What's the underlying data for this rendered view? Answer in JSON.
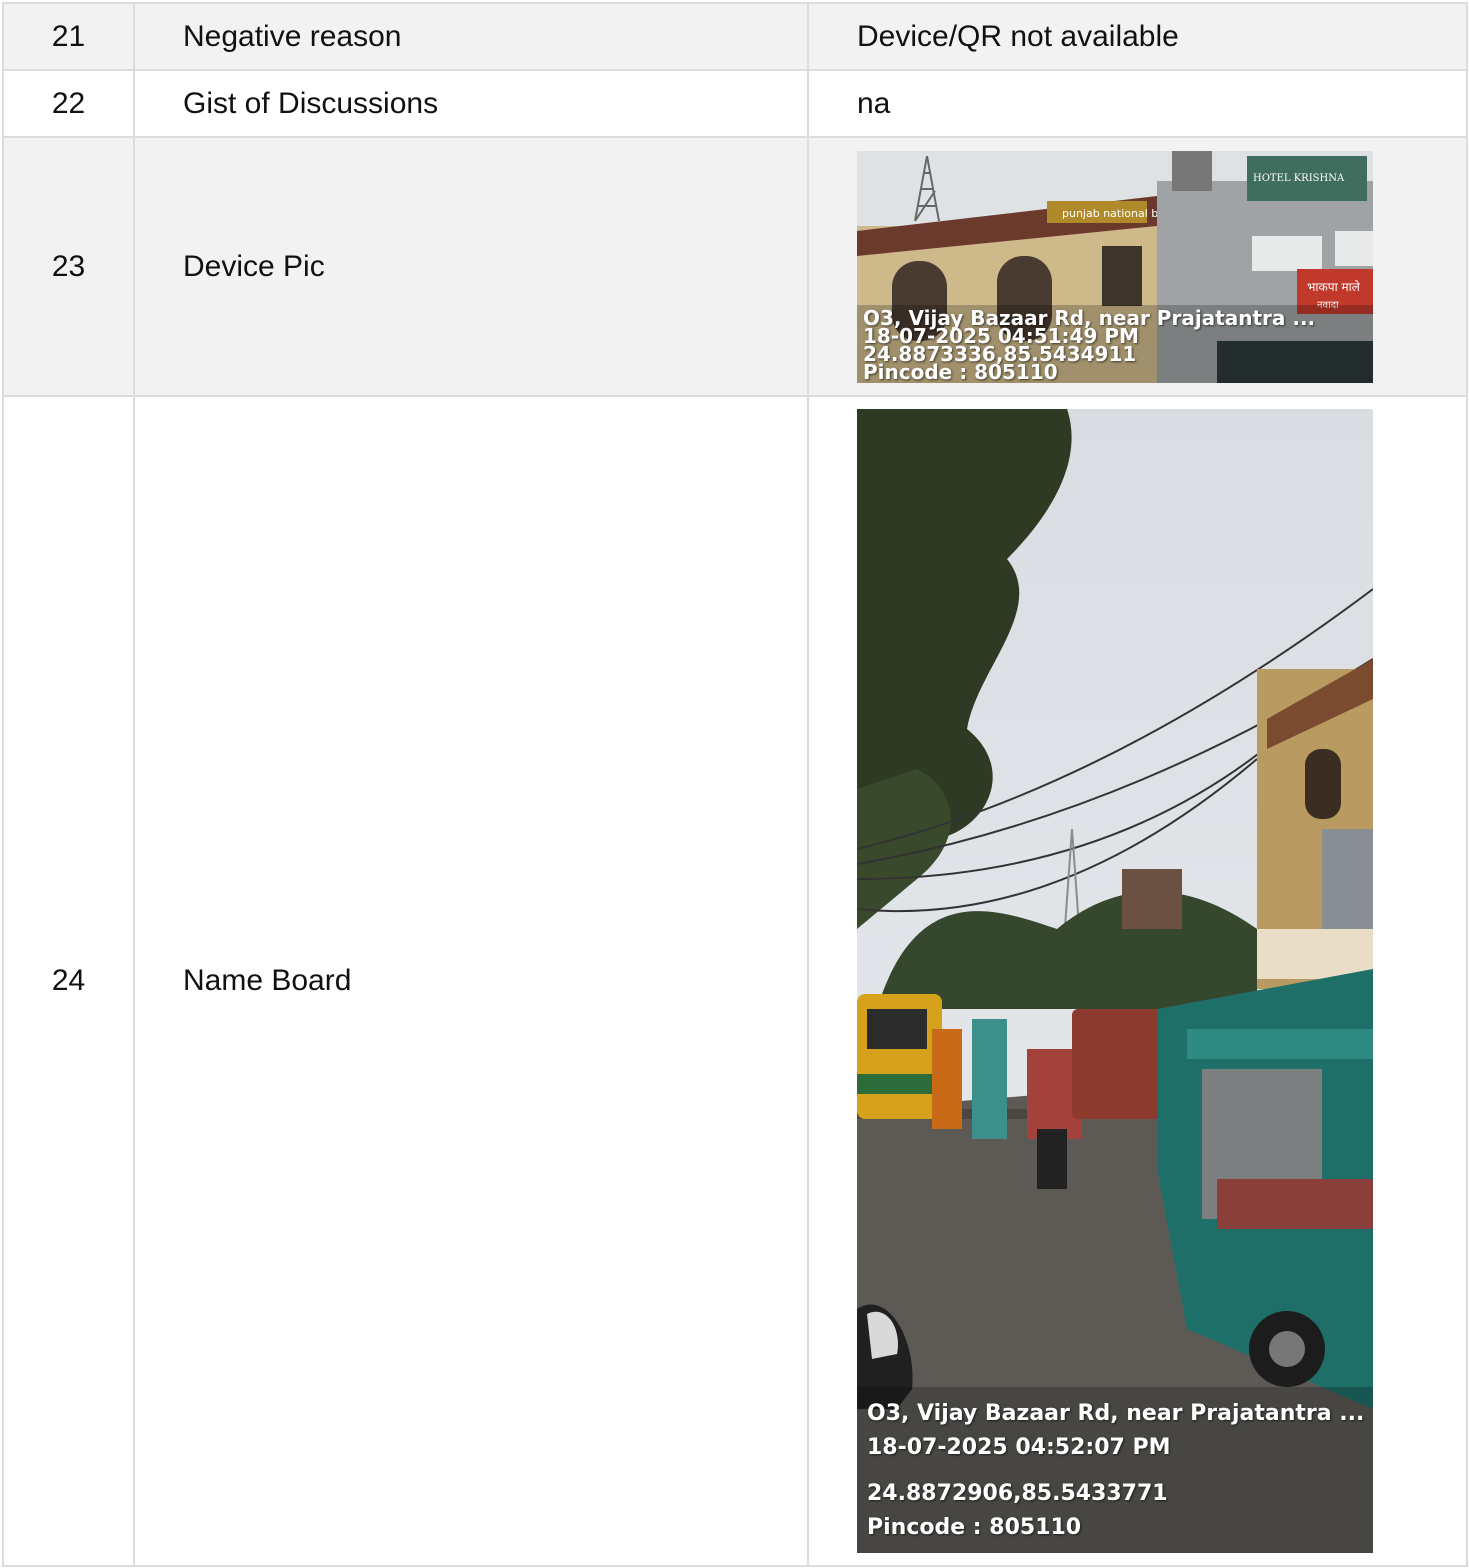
{
  "rows": [
    {
      "num": "21",
      "label": "Negative reason",
      "value": "Device/QR not available"
    },
    {
      "num": "22",
      "label": "Gist of Discussions",
      "value": "na"
    },
    {
      "num": "23",
      "label": "Device Pic",
      "photo": {
        "address": "O3, Vijay Bazaar Rd, near Prajatantra ...",
        "datetime": "18-07-2025 04:51:49 PM",
        "coords": "24.8873336,85.5434911",
        "pincode": "Pincode : 805110",
        "signs": [
          "punjab national bank",
          "HOTEL KRISHNA",
          "भाकपा माले",
          "नवादा"
        ]
      }
    },
    {
      "num": "24",
      "label": "Name Board",
      "photo": {
        "address": "O3, Vijay Bazaar Rd, near Prajatantra ...",
        "datetime": "18-07-2025 04:52:07 PM",
        "coords": "24.8872906,85.5433771",
        "pincode": "Pincode : 805110"
      }
    }
  ],
  "colors": {
    "border": "#dcdcdc",
    "shade": "#f2f2f2"
  }
}
